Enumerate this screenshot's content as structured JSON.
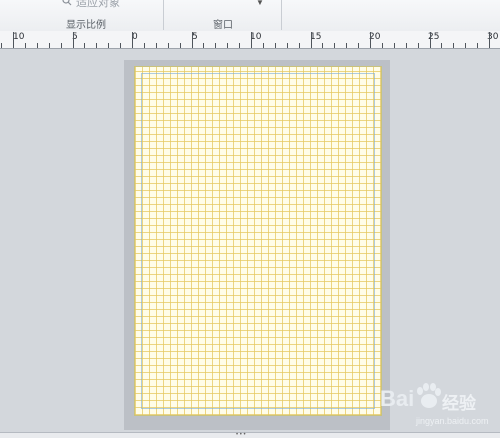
{
  "ribbon": {
    "groups": [
      {
        "label": "显示比例"
      },
      {
        "label": "窗口"
      }
    ],
    "cut_off_button_label": "适应对象",
    "cut_off_icon": "zoom-icon"
  },
  "ruler": {
    "labels": [
      "10",
      "5",
      "0",
      "5",
      "10",
      "15",
      "20",
      "25",
      "30"
    ]
  },
  "watermark": {
    "brand": "Bai",
    "brand_suffix": "经验",
    "url": "jingyan.baidu.com",
    "colors": {
      "paw": "#e9edf1"
    }
  },
  "colors": {
    "grid_line": "#e5c85f",
    "page_fill": "#fffde9",
    "workspace": "#d3d7dc",
    "page_shadow": "#bcc0c6"
  }
}
